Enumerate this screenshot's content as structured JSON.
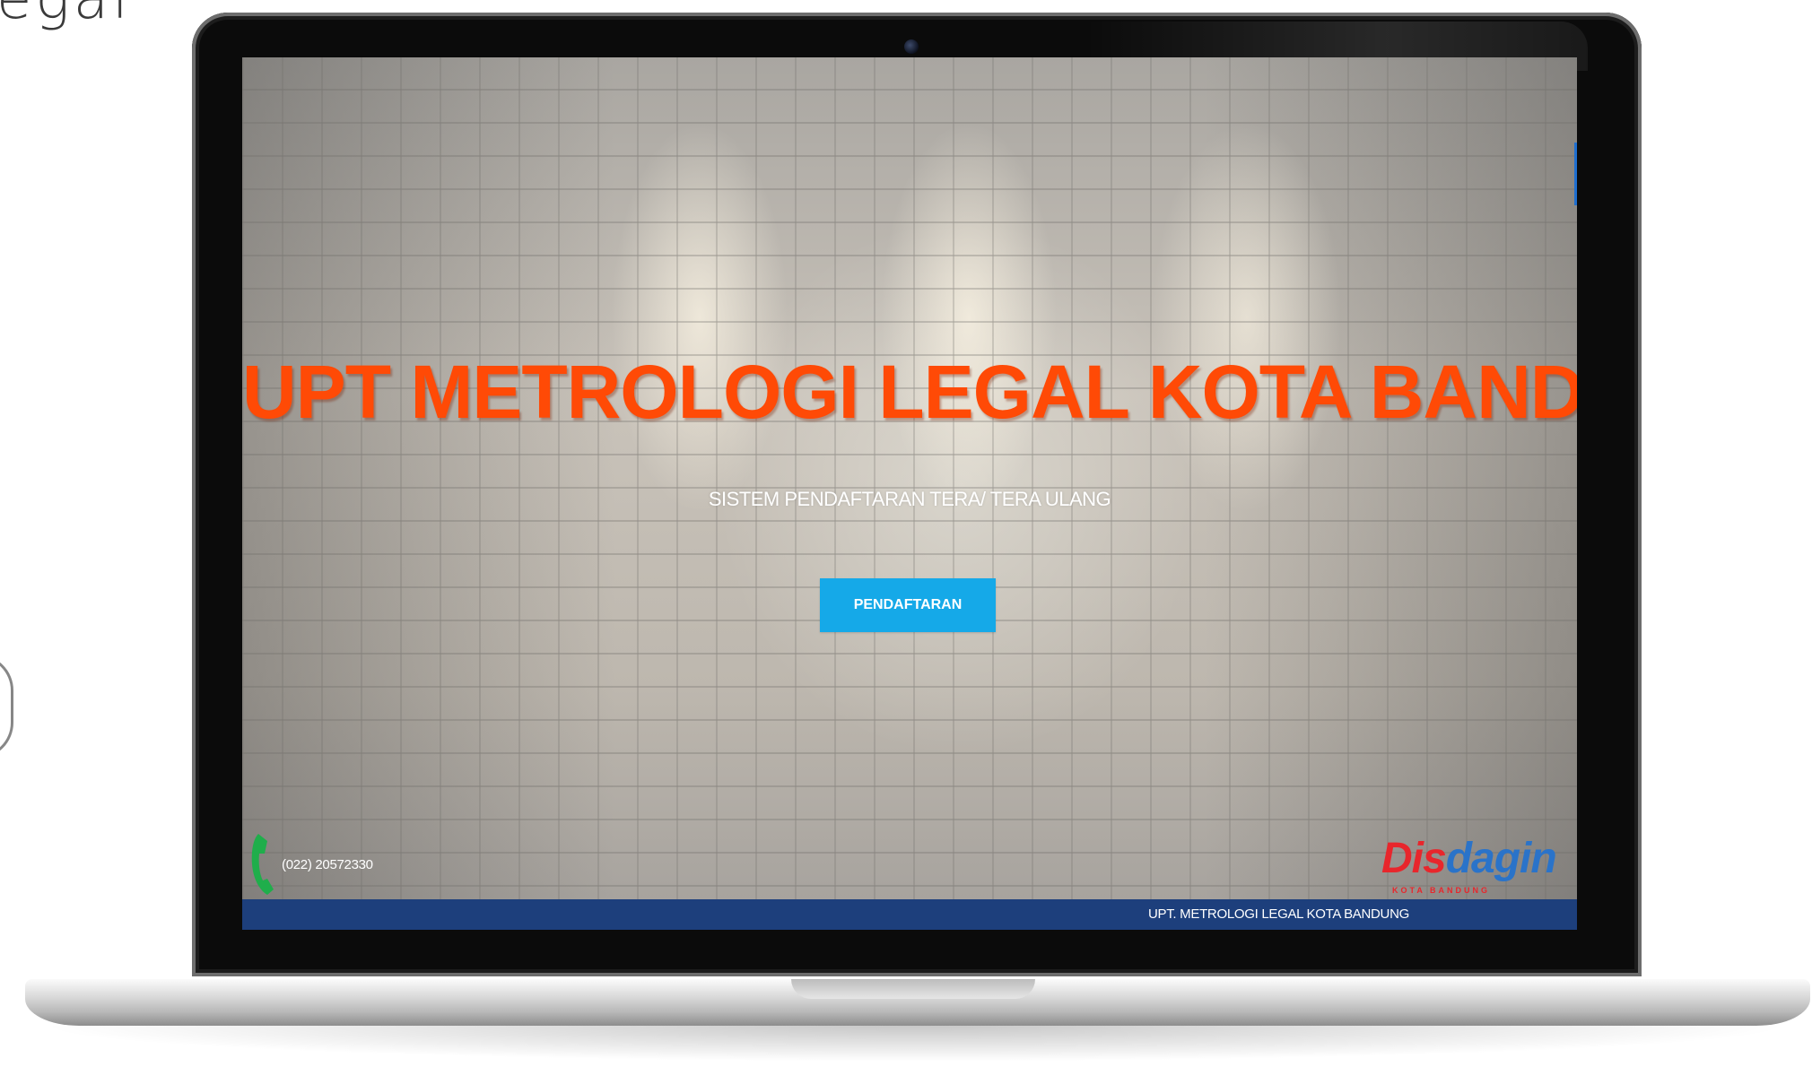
{
  "corner_text": "egal",
  "site": {
    "title": "UPT METROLOGI LEGAL KOTA BANDUNG",
    "subtitle": "SISTEM PENDAFTARAN TERA/ TERA ULANG",
    "button_label": "PENDAFTARAN",
    "phone": "(022) 20572330",
    "logo_text_a": "Dis",
    "logo_text_b": "dagin",
    "logo_sub": "KOTA BANDUNG",
    "footer_text": "UPT. METROLOGI LEGAL KOTA BANDUNG"
  },
  "colors": {
    "title": "#ff4a06",
    "button": "#15a9e8",
    "footer": "#1d3f7c",
    "phone_icon": "#1fae4b",
    "logo_red": "#e8262c",
    "logo_blue": "#2a73c9"
  },
  "icons": [
    "phone-icon",
    "disdagin-logo"
  ]
}
